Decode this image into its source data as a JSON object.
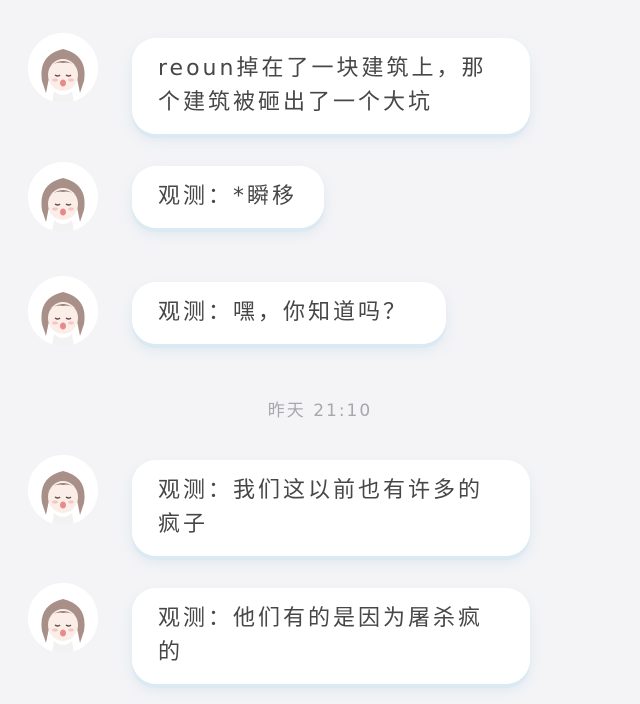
{
  "conversation": {
    "messages": [
      {
        "avatar": "anime-girl-avatar",
        "text": "reoun掉在了一块建筑上，那个建筑被砸出了一个大坑"
      },
      {
        "avatar": "anime-girl-avatar",
        "text": "观测：*瞬移"
      },
      {
        "avatar": "anime-girl-avatar",
        "text": "观测：嘿，你知道吗？"
      },
      {
        "avatar": "anime-girl-avatar",
        "text": "观测：我们这以前也有许多的疯子"
      },
      {
        "avatar": "anime-girl-avatar",
        "text": "观测：他们有的是因为屠杀疯的"
      }
    ],
    "timestamp": "昨天 21:10"
  },
  "colors": {
    "background": "#f4f4f6",
    "bubble": "#ffffff",
    "bubble_shadow": "#dbe9f2",
    "timestamp_text": "#a8a8ac",
    "message_text": "#474747"
  }
}
